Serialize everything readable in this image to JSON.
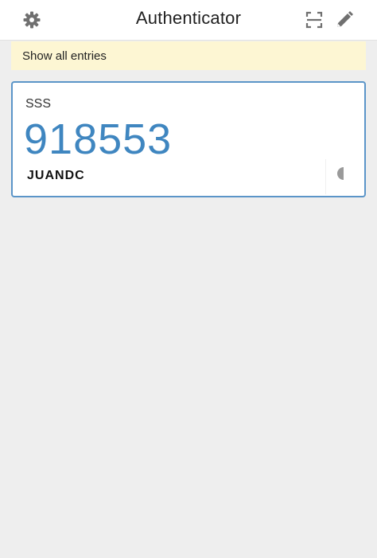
{
  "header": {
    "title": "Authenticator",
    "icons": [
      "gear-icon",
      "scan-qr-icon",
      "pencil-icon"
    ]
  },
  "notice": {
    "text": "Show all entries"
  },
  "entries": [
    {
      "issuer": "SSS",
      "code": "918553",
      "account": "JUANDC",
      "timer_remaining_fraction": 0.5
    }
  ],
  "colors": {
    "accent": "#3f86c0",
    "border": "#5b95c8",
    "notice_bg": "#fdf6d3",
    "background": "#eeeeee"
  }
}
